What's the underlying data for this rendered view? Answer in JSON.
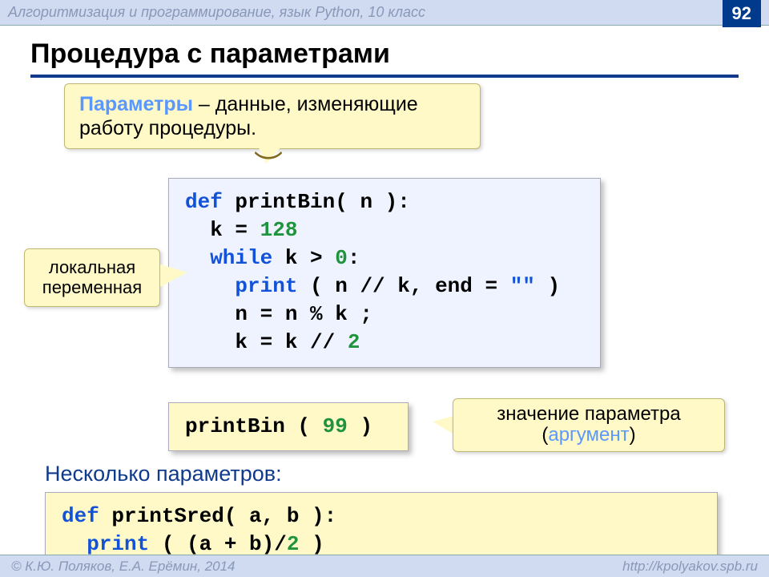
{
  "header": {
    "title": "Алгоритмизация и программирование, язык Python, 10 класс",
    "page_number": "92"
  },
  "heading": "Процедура с параметрами",
  "callout_params": {
    "term": "Параметры",
    "rest": " – данные, изменяющие работу процедуры."
  },
  "code_main": {
    "l1_def": "def",
    "l1_rest": " printBin( n ):",
    "l2_pre": "  k = ",
    "l2_num": "128",
    "l3_while": "  while",
    "l3_mid": " k > ",
    "l3_zero": "0",
    "l3_colon": ":",
    "l4_pre": "    ",
    "l4_print": "print",
    "l4_open": " ( n // k, end = ",
    "l4_str": "\"\"",
    "l4_close": " )",
    "l5": "    n = n % k ;",
    "l6_pre": "    k = k // ",
    "l6_two": "2"
  },
  "callout_localvar": {
    "line1": "локальная",
    "line2": "переменная"
  },
  "code_call": {
    "name": "printBin ( ",
    "arg": "99",
    "close": " )"
  },
  "callout_arg": {
    "line1": "значение параметра",
    "line2_open": "(",
    "line2_arg": "аргумент",
    "line2_close": ")"
  },
  "sub_heading": "Несколько параметров:",
  "code_sred": {
    "l1_def": "def",
    "l1_rest": " printSred( a, b ):",
    "l2_pre": "  ",
    "l2_print": "print",
    "l2_mid": " ( (a + b)/",
    "l2_two": "2",
    "l2_close": " )"
  },
  "footer": {
    "left": "© К.Ю. Поляков, Е.А. Ерёмин, 2014",
    "right": "http://kpolyakov.spb.ru"
  }
}
